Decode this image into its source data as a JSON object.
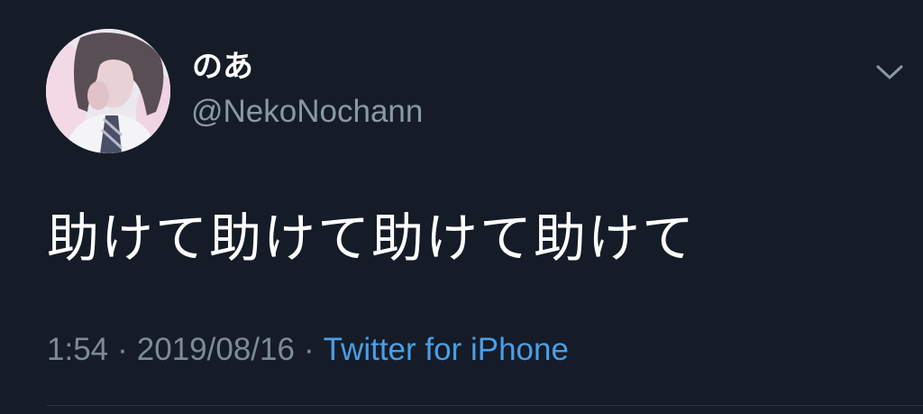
{
  "tweet": {
    "author": {
      "display_name": "のあ",
      "handle": "@NekoNochann",
      "avatar_icon": "profile-photo"
    },
    "text": "助けて助けて助けて助けて",
    "time": "1:54",
    "date": "2019/08/16",
    "separator": "·",
    "source": "Twitter for iPhone",
    "menu_icon": "chevron-down-icon"
  },
  "colors": {
    "background": "#151c28",
    "primary_text": "#ffffff",
    "secondary_text": "#8b98a5",
    "link": "#4a9fe6"
  }
}
